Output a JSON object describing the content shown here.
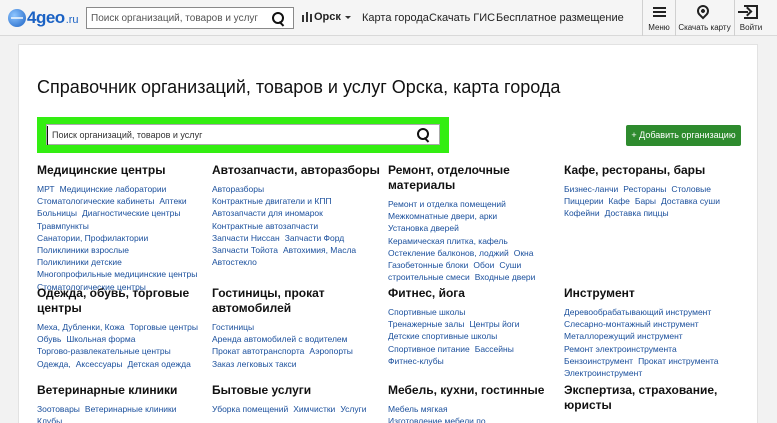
{
  "header": {
    "logo_text": "4geo",
    "logo_tld": ".ru",
    "search_placeholder": "Поиск организаций, товаров и услуг",
    "city": "Орск",
    "nav": [
      "Карта города",
      "Скачать ГИС",
      "Бесплатное размещение"
    ],
    "menu_label": "Меню",
    "download_map_label": "Скачать карту",
    "login_label": "Войти"
  },
  "main": {
    "title": "Справочник организаций, товаров и услуг Орска, карта города",
    "search_placeholder": "Поиск организаций, товаров и услуг",
    "add_org_label": "+ Добавить организацию"
  },
  "categories": [
    {
      "title": "Медицинские центры",
      "links": [
        "МРТ",
        "Медицинские лаборатории",
        "Стоматологические кабинеты",
        "Аптеки",
        "Больницы",
        "Диагностические центры",
        "Травмпункты",
        "Санатории, Профилактории",
        "Поликлиники взрослые",
        "Поликлиники детские",
        "Многопрофильные медицинские центры",
        "Стоматологические центры"
      ]
    },
    {
      "title": "Автозапчасти, авторазборы",
      "links": [
        "Авторазборы",
        "Контрактные двигатели и КПП",
        "Автозапчасти для иномарок",
        "Контрактные автозапчасти",
        "Запчасти Ниссан",
        "Запчасти Форд",
        "Запчасти Тойота",
        "Автохимия, Масла",
        "Автостекло"
      ]
    },
    {
      "title": "Ремонт, отделочные материалы",
      "links": [
        "Ремонт и отделка помещений",
        "Межкомнатные двери, арки",
        "Установка дверей",
        "Керамическая плитка, кафель",
        "Остекление балконов, лоджий",
        "Окна",
        "Газобетонные блоки",
        "Обои",
        "Суши",
        "строительные смеси",
        "Входные двери"
      ]
    },
    {
      "title": "Кафе, рестораны, бары",
      "links": [
        "Бизнес-ланчи",
        "Рестораны",
        "Столовые",
        "Пиццерии",
        "Кафе",
        "Бары",
        "Доставка суши",
        "Кофейни",
        "Доставка пиццы"
      ]
    },
    {
      "title": "Одежда, обувь, торговые центры",
      "links": [
        "Меха, Дубленки, Кожа",
        "Торговые центры",
        "Обувь",
        "Школьная форма",
        "Торгово-развлекательные центры",
        "Одежда,",
        "Аксессуары",
        "Детская одежда"
      ]
    },
    {
      "title": "Гостиницы, прокат автомобилей",
      "links": [
        "Гостиницы",
        "Аренда автомобилей с водителем",
        "Прокат автотранспорта",
        "Аэропорты",
        "Заказ легковых такси"
      ]
    },
    {
      "title": "Фитнес, йога",
      "links": [
        "Спортивные школы",
        "Тренажерные залы",
        "Центры йоги",
        "Детские спортивные школы",
        "Спортивное питание",
        "Бассейны",
        "Фитнес-клубы"
      ]
    },
    {
      "title": "Инструмент",
      "links": [
        "Деревообрабатывающий инструмент",
        "Слесарно-монтажный инструмент",
        "Металлорежущий инструмент",
        "Ремонт электроинструмента",
        "Бензоинструмент",
        "Прокат инструмента",
        "Электроинструмент"
      ]
    },
    {
      "title": "Ветеринарные клиники",
      "links": [
        "Зоотовары",
        "Ветеринарные клиники",
        "Клубы"
      ]
    },
    {
      "title": "Бытовые услуги",
      "links": [
        "Уборка помещений",
        "Химчистки",
        "Услуги"
      ]
    },
    {
      "title": "Мебель, кухни, гостинные",
      "links": [
        "Мебель мягкая",
        "Изготовление мебели по"
      ]
    },
    {
      "title": "Экспертиза, страхование, юристы",
      "links": []
    }
  ]
}
